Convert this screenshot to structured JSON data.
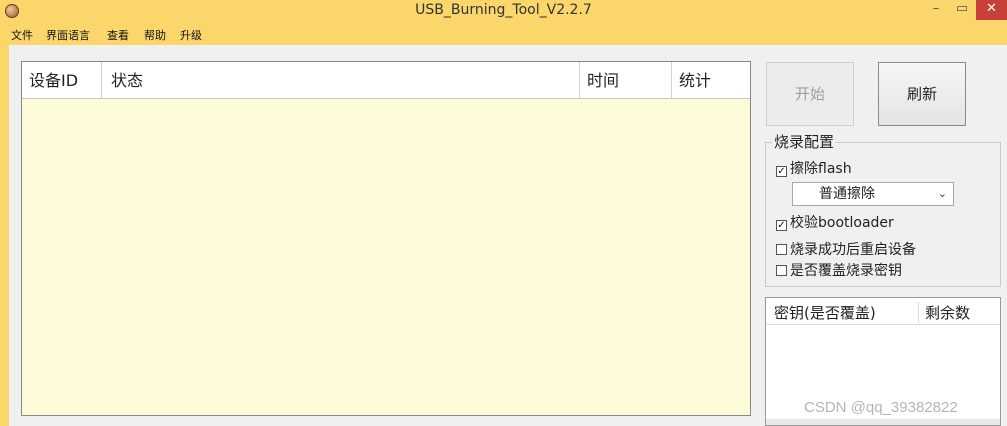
{
  "window": {
    "title": "USB_Burning_Tool_V2.2.7"
  },
  "menu": [
    "文件",
    "界面语言",
    "查看",
    "帮助",
    "升级"
  ],
  "table": {
    "columns": [
      "设备ID",
      "状态",
      "时间",
      "统计"
    ],
    "rows": []
  },
  "buttons": {
    "start": "开始",
    "refresh": "刷新"
  },
  "config": {
    "title": "烧录配置",
    "erase_flash": {
      "label": "擦除flash",
      "checked": true
    },
    "erase_mode": {
      "selected": "普通擦除"
    },
    "verify_bootloader": {
      "label": "校验bootloader",
      "checked": true
    },
    "reboot_after": {
      "label": "烧录成功后重启设备",
      "checked": false
    },
    "overwrite_key": {
      "label": "是否覆盖烧录密钥",
      "checked": false
    }
  },
  "key_list": {
    "columns": [
      "密钥(是否覆盖)",
      "剩余数"
    ],
    "rows": []
  },
  "watermark": "CSDN @qq_39382822",
  "colors": {
    "title_bar": "#fbd66b",
    "table_bg": "#fdfad7",
    "close_button": "#c7413a"
  }
}
